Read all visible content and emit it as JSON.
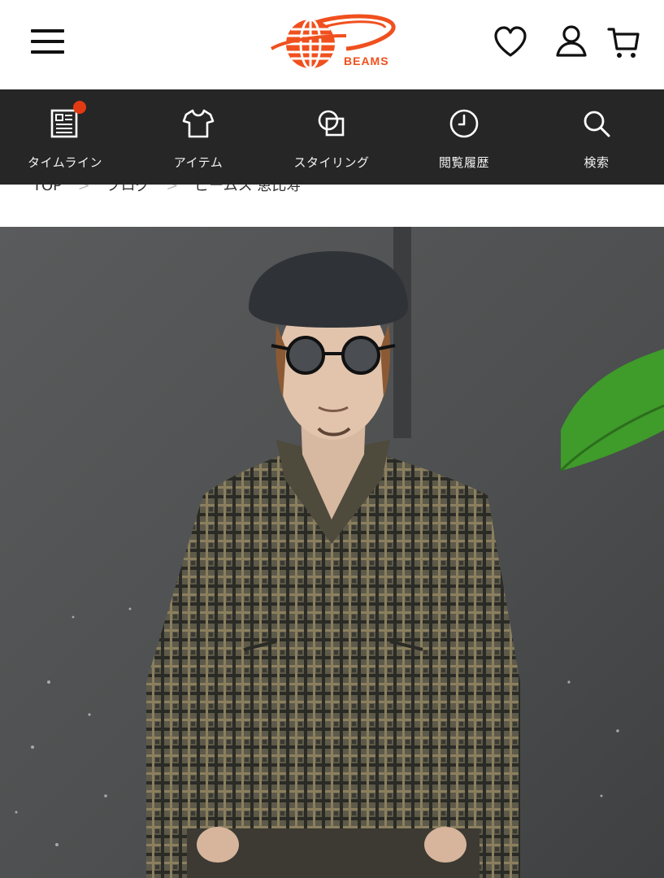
{
  "header": {
    "logo_text": "BEAMS",
    "brand_color": "#F0501E",
    "icons": [
      "menu-icon",
      "heart-icon",
      "user-icon",
      "cart-icon"
    ]
  },
  "nav": {
    "items": [
      {
        "label": "タイムライン",
        "icon": "timeline-icon"
      },
      {
        "label": "アイテム",
        "icon": "tshirt-icon"
      },
      {
        "label": "スタイリング",
        "icon": "styling-icon"
      },
      {
        "label": "閲覧履歴",
        "icon": "clock-icon"
      },
      {
        "label": "検索",
        "icon": "search-icon"
      }
    ],
    "badge_color": "#E23A12"
  },
  "breadcrumb": {
    "items": [
      "TOP",
      "ブログ",
      "ビームス 恵比寿"
    ]
  },
  "photo": {
    "alt": ""
  }
}
